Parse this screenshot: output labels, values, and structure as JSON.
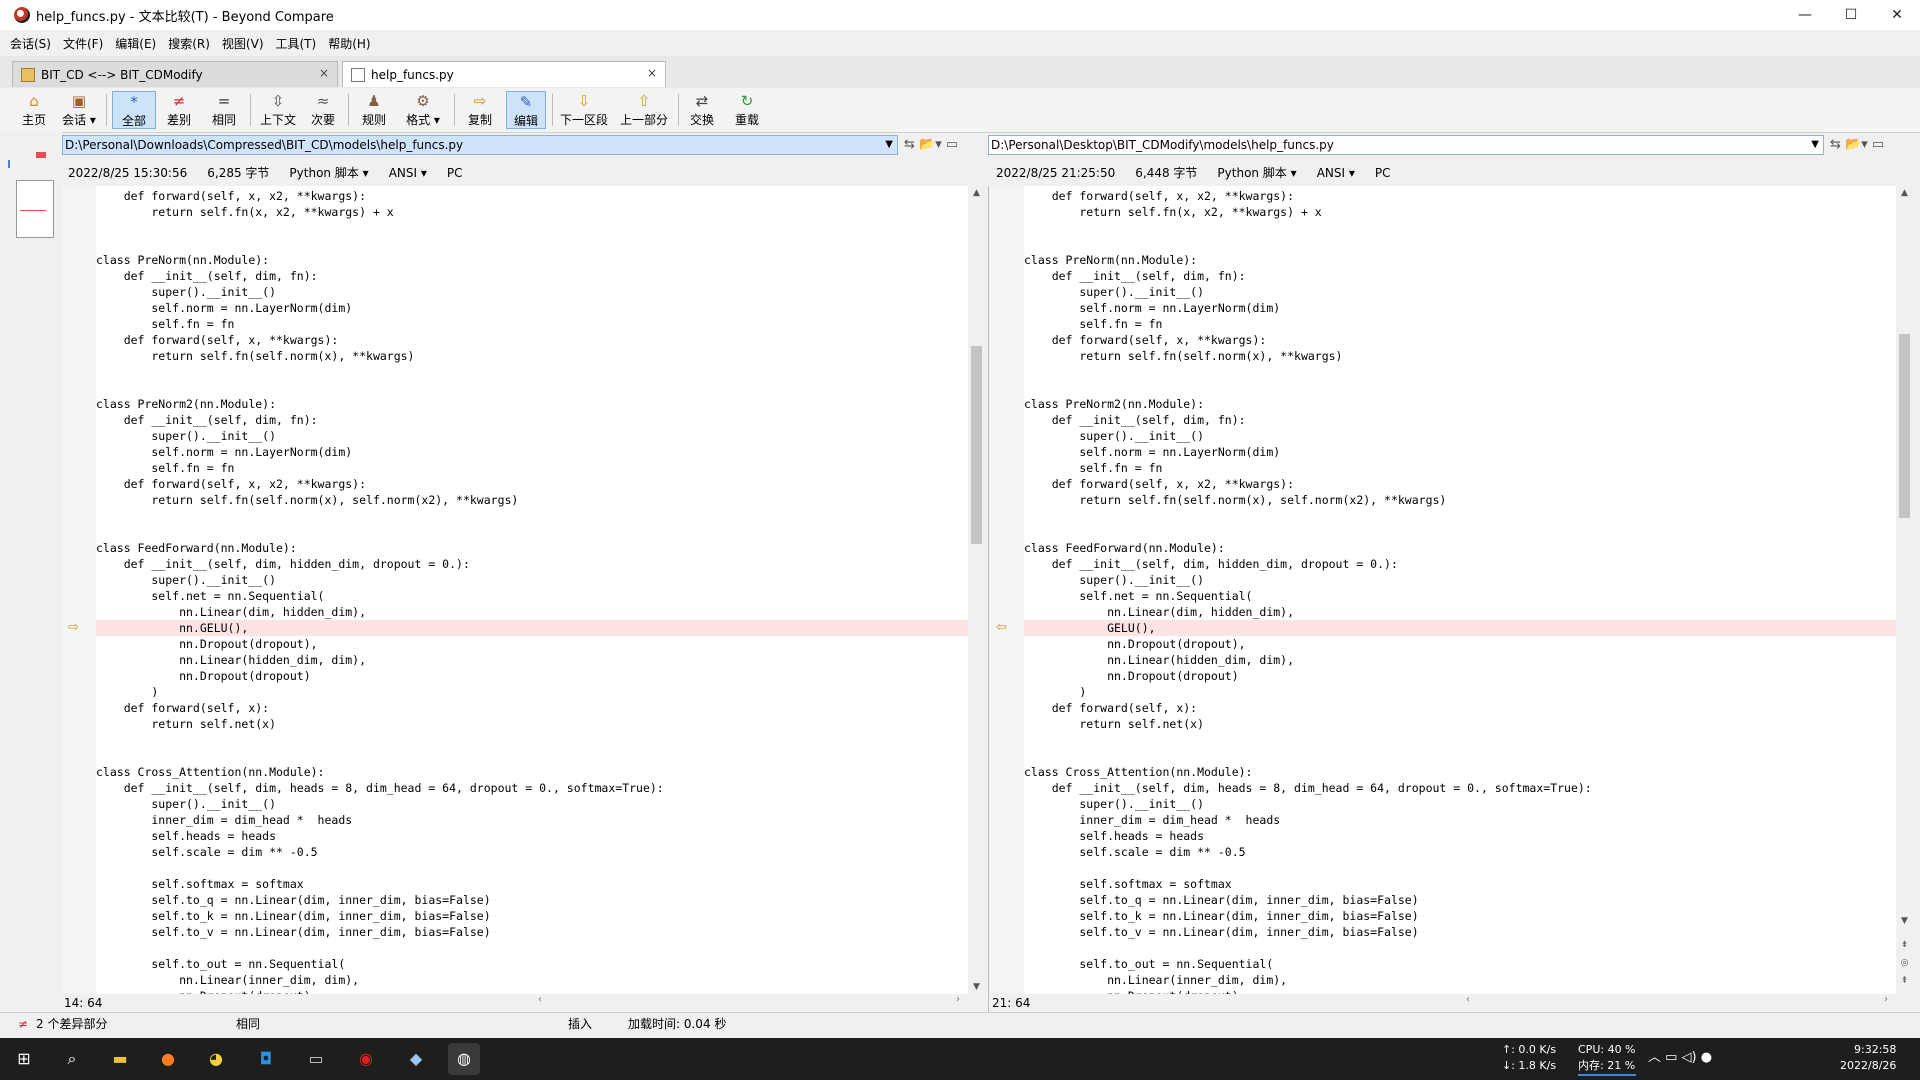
{
  "window": {
    "title": "help_funcs.py - 文本比较(T) - Beyond Compare",
    "controls": [
      "—",
      "☐",
      "✕"
    ]
  },
  "menu": [
    "会话(S)",
    "文件(F)",
    "编辑(E)",
    "搜索(R)",
    "视图(V)",
    "工具(T)",
    "帮助(H)"
  ],
  "tabs": [
    {
      "label": "BIT_CD <--> BIT_CDModify",
      "close": "×"
    },
    {
      "label": "help_funcs.py",
      "close": "×"
    }
  ],
  "toolbar": {
    "home": "主页",
    "session": "会话",
    "all": "全部",
    "diffs": "差别",
    "same": "相同",
    "context": "上下文",
    "minor": "次要",
    "rules": "规则",
    "format": "格式",
    "copy": "复制",
    "edit": "编辑",
    "next_section": "下一区段",
    "prev_part": "上一部分",
    "swap": "交换",
    "reload": "重载"
  },
  "left": {
    "path": "D:\\Personal\\Downloads\\Compressed\\BIT_CD\\models\\help_funcs.py",
    "timestamp": "2022/8/25 15:30:56",
    "size": "6,285 字节",
    "format": "Python 脚本",
    "encoding": "ANSI",
    "lineend": "PC",
    "position": "14: 64"
  },
  "right": {
    "path": "D:\\Personal\\Desktop\\BIT_CDModify\\models\\help_funcs.py",
    "timestamp": "2022/8/25 21:25:50",
    "size": "6,448 字节",
    "format": "Python 脚本",
    "encoding": "ANSI",
    "lineend": "PC",
    "position": "21: 64"
  },
  "code_left": [
    "    def forward(self, x, x2, **kwargs):",
    "        return self.fn(x, x2, **kwargs) + x",
    "",
    "",
    "class PreNorm(nn.Module):",
    "    def __init__(self, dim, fn):",
    "        super().__init__()",
    "        self.norm = nn.LayerNorm(dim)",
    "        self.fn = fn",
    "    def forward(self, x, **kwargs):",
    "        return self.fn(self.norm(x), **kwargs)",
    "",
    "",
    "class PreNorm2(nn.Module):",
    "    def __init__(self, dim, fn):",
    "        super().__init__()",
    "        self.norm = nn.LayerNorm(dim)",
    "        self.fn = fn",
    "    def forward(self, x, x2, **kwargs):",
    "        return self.fn(self.norm(x), self.norm(x2), **kwargs)",
    "",
    "",
    "class FeedForward(nn.Module):",
    "    def __init__(self, dim, hidden_dim, dropout = 0.):",
    "        super().__init__()",
    "        self.net = nn.Sequential(",
    "            nn.Linear(dim, hidden_dim),",
    "            nn.GELU(),",
    "            nn.Dropout(dropout),",
    "            nn.Linear(hidden_dim, dim),",
    "            nn.Dropout(dropout)",
    "        )",
    "    def forward(self, x):",
    "        return self.net(x)",
    "",
    "",
    "class Cross_Attention(nn.Module):",
    "    def __init__(self, dim, heads = 8, dim_head = 64, dropout = 0., softmax=True):",
    "        super().__init__()",
    "        inner_dim = dim_head *  heads",
    "        self.heads = heads",
    "        self.scale = dim ** -0.5",
    "",
    "        self.softmax = softmax",
    "        self.to_q = nn.Linear(dim, inner_dim, bias=False)",
    "        self.to_k = nn.Linear(dim, inner_dim, bias=False)",
    "        self.to_v = nn.Linear(dim, inner_dim, bias=False)",
    "",
    "        self.to_out = nn.Sequential(",
    "            nn.Linear(inner_dim, dim),",
    "            nn.Dropout(dropout)"
  ],
  "code_right": [
    "    def forward(self, x, x2, **kwargs):",
    "        return self.fn(x, x2, **kwargs) + x",
    "",
    "",
    "class PreNorm(nn.Module):",
    "    def __init__(self, dim, fn):",
    "        super().__init__()",
    "        self.norm = nn.LayerNorm(dim)",
    "        self.fn = fn",
    "    def forward(self, x, **kwargs):",
    "        return self.fn(self.norm(x), **kwargs)",
    "",
    "",
    "class PreNorm2(nn.Module):",
    "    def __init__(self, dim, fn):",
    "        super().__init__()",
    "        self.norm = nn.LayerNorm(dim)",
    "        self.fn = fn",
    "    def forward(self, x, x2, **kwargs):",
    "        return self.fn(self.norm(x), self.norm(x2), **kwargs)",
    "",
    "",
    "class FeedForward(nn.Module):",
    "    def __init__(self, dim, hidden_dim, dropout = 0.):",
    "        super().__init__()",
    "        self.net = nn.Sequential(",
    "            nn.Linear(dim, hidden_dim),",
    "            GELU(),",
    "            nn.Dropout(dropout),",
    "            nn.Linear(hidden_dim, dim),",
    "            nn.Dropout(dropout)",
    "        )",
    "    def forward(self, x):",
    "        return self.net(x)",
    "",
    "",
    "class Cross_Attention(nn.Module):",
    "    def __init__(self, dim, heads = 8, dim_head = 64, dropout = 0., softmax=True):",
    "        super().__init__()",
    "        inner_dim = dim_head *  heads",
    "        self.heads = heads",
    "        self.scale = dim ** -0.5",
    "",
    "        self.softmax = softmax",
    "        self.to_q = nn.Linear(dim, inner_dim, bias=False)",
    "        self.to_k = nn.Linear(dim, inner_dim, bias=False)",
    "        self.to_v = nn.Linear(dim, inner_dim, bias=False)",
    "",
    "        self.to_out = nn.Sequential(",
    "            nn.Linear(inner_dim, dim),",
    "            nn.Dropout(dropout)"
  ],
  "diff_line_index": 27,
  "status": {
    "diffs": "2 个差异部分",
    "same": "相同",
    "mode": "插入",
    "load_time": "加载时间: 0.04 秒"
  },
  "taskbar": {
    "net_up": "↑: 0.0 K/s",
    "net_down": "↓: 1.8 K/s",
    "cpu": "CPU: 40 %",
    "mem": "内存: 21 %",
    "time": "9:32:58",
    "date": "2022/8/26"
  },
  "colors": {
    "diff_bg": "#fde3e3",
    "diff_text": "#c02020",
    "accent": "#4a7ed0"
  }
}
